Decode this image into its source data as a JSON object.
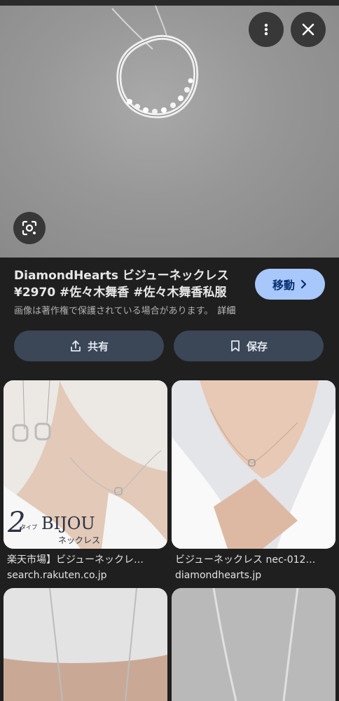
{
  "hero": {
    "more_icon": "more-vert-icon",
    "close_icon": "close-icon",
    "lens_icon": "lens-search-icon"
  },
  "result": {
    "title": "DiamondHearts ビジューネックレス ¥2970 #佐々木舞香 #佐々木舞香私服",
    "goto_label": "移動",
    "copyright": "画像は著作権で保護されている場合があります。",
    "detail_link": "詳細"
  },
  "actions": {
    "share_label": "共有",
    "save_label": "保存"
  },
  "related": [
    {
      "title": "楽天市場】ビジューネックレ…",
      "source": "search.rakuten.co.jp",
      "image_text": "BIJOU",
      "image_sub": "ネックレス",
      "image_num": "2",
      "image_num_sub": "タイプ"
    },
    {
      "title": "ビジューネックレス nec-012…",
      "source": "diamondhearts.jp"
    },
    {
      "title": "",
      "source": ""
    },
    {
      "title": "",
      "source": ""
    }
  ],
  "colors": {
    "background": "#1f1f1f",
    "goto_button": "#a8c7fa",
    "action_button": "#3b4656"
  }
}
